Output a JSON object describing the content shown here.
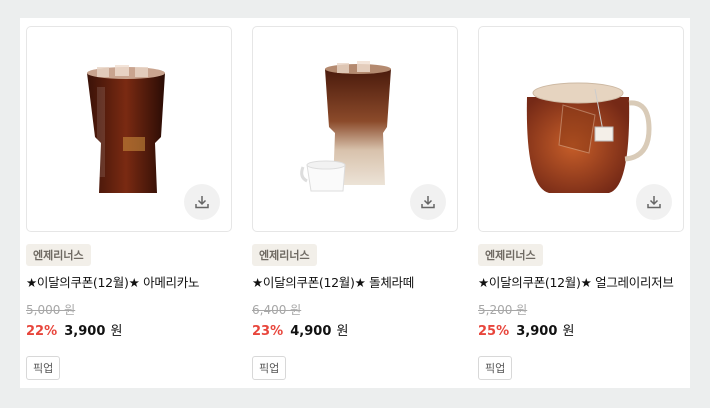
{
  "products": [
    {
      "brand": "엔제리너스",
      "title": "★이달의쿠폰(12월)★ 아메리카노",
      "original_price": "5,000 원",
      "discount": "22%",
      "price": "3,900",
      "currency": "원",
      "tag": "픽업",
      "image_icon": "iced-americano-image"
    },
    {
      "brand": "엔제리너스",
      "title": "★이달의쿠폰(12월)★ 돌체라떼",
      "original_price": "6,400 원",
      "discount": "23%",
      "price": "4,900",
      "currency": "원",
      "tag": "픽업",
      "image_icon": "iced-dolce-latte-image"
    },
    {
      "brand": "엔제리너스",
      "title": "★이달의쿠폰(12월)★ 얼그레이리저브",
      "original_price": "5,200 원",
      "discount": "25%",
      "price": "3,900",
      "currency": "원",
      "tag": "픽업",
      "image_icon": "earl-grey-tea-image"
    }
  ],
  "colors": {
    "discount": "#e8463c",
    "brand_badge_bg": "#f2efe9",
    "page_bg": "#eceeee"
  }
}
